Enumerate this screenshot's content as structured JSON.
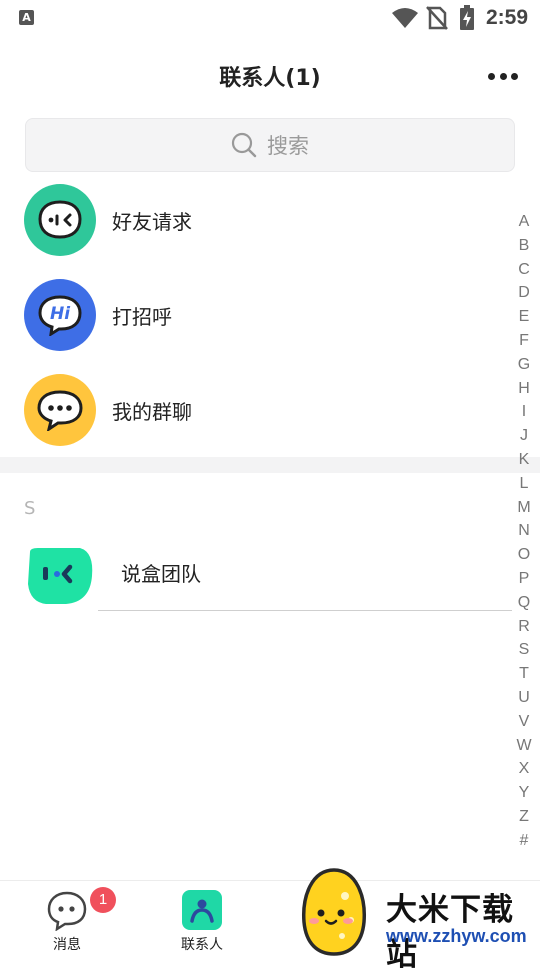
{
  "status_bar": {
    "time": "2:59",
    "notification_letter": "A"
  },
  "header": {
    "title": "联系人(1)"
  },
  "search": {
    "placeholder": "搜索"
  },
  "rows": [
    {
      "label": "好友请求",
      "icon": "friend-request-icon",
      "color": "#2fc79a"
    },
    {
      "label": "打招呼",
      "icon": "hi-bubble-icon",
      "color": "#3e6ee6",
      "icon_text": "Hi"
    },
    {
      "label": "我的群聊",
      "icon": "group-chat-icon",
      "color": "#ffc53d"
    }
  ],
  "section": {
    "letter": "S"
  },
  "contacts": [
    {
      "name": "说盒团队",
      "color": "#1fe2a4"
    }
  ],
  "alphabet": [
    "A",
    "B",
    "C",
    "D",
    "E",
    "F",
    "G",
    "H",
    "I",
    "J",
    "K",
    "L",
    "M",
    "N",
    "O",
    "P",
    "Q",
    "R",
    "S",
    "T",
    "U",
    "V",
    "W",
    "X",
    "Y",
    "Z",
    "#"
  ],
  "tabs": [
    {
      "label": "消息",
      "badge": "1"
    },
    {
      "label": "联系人",
      "active": true
    }
  ],
  "watermark": {
    "title": "大米下载站",
    "url": "www.zzhyw.com"
  },
  "colors": {
    "accent": "#1fd8a6",
    "badge": "#f0505c"
  }
}
